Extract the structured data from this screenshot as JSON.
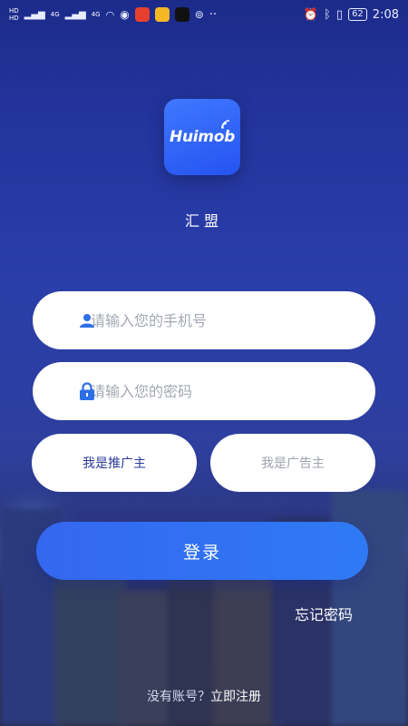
{
  "status_bar": {
    "time": "2:08",
    "battery": "62",
    "signal_left": [
      "HD",
      "HD"
    ],
    "net_labels": [
      "4G",
      "4G"
    ]
  },
  "logo": {
    "wordmark": "Huimob"
  },
  "app_name": "汇盟",
  "phone_input": {
    "placeholder": "请输入您的手机号",
    "value": ""
  },
  "password_input": {
    "placeholder": "请输入您的密码",
    "value": ""
  },
  "roles": {
    "promoter": "我是推广主",
    "advertiser": "我是广告主",
    "selected": "promoter"
  },
  "login_label": "登录",
  "forgot_label": "忘记密码",
  "footer": {
    "prompt": "没有账号？",
    "register": "立即注册"
  },
  "colors": {
    "primary": "#2f6ff2",
    "bg_top": "#1c2b8a",
    "selected_role_text": "#2a3a9c",
    "unselected_role_text": "#9ea3ad"
  }
}
